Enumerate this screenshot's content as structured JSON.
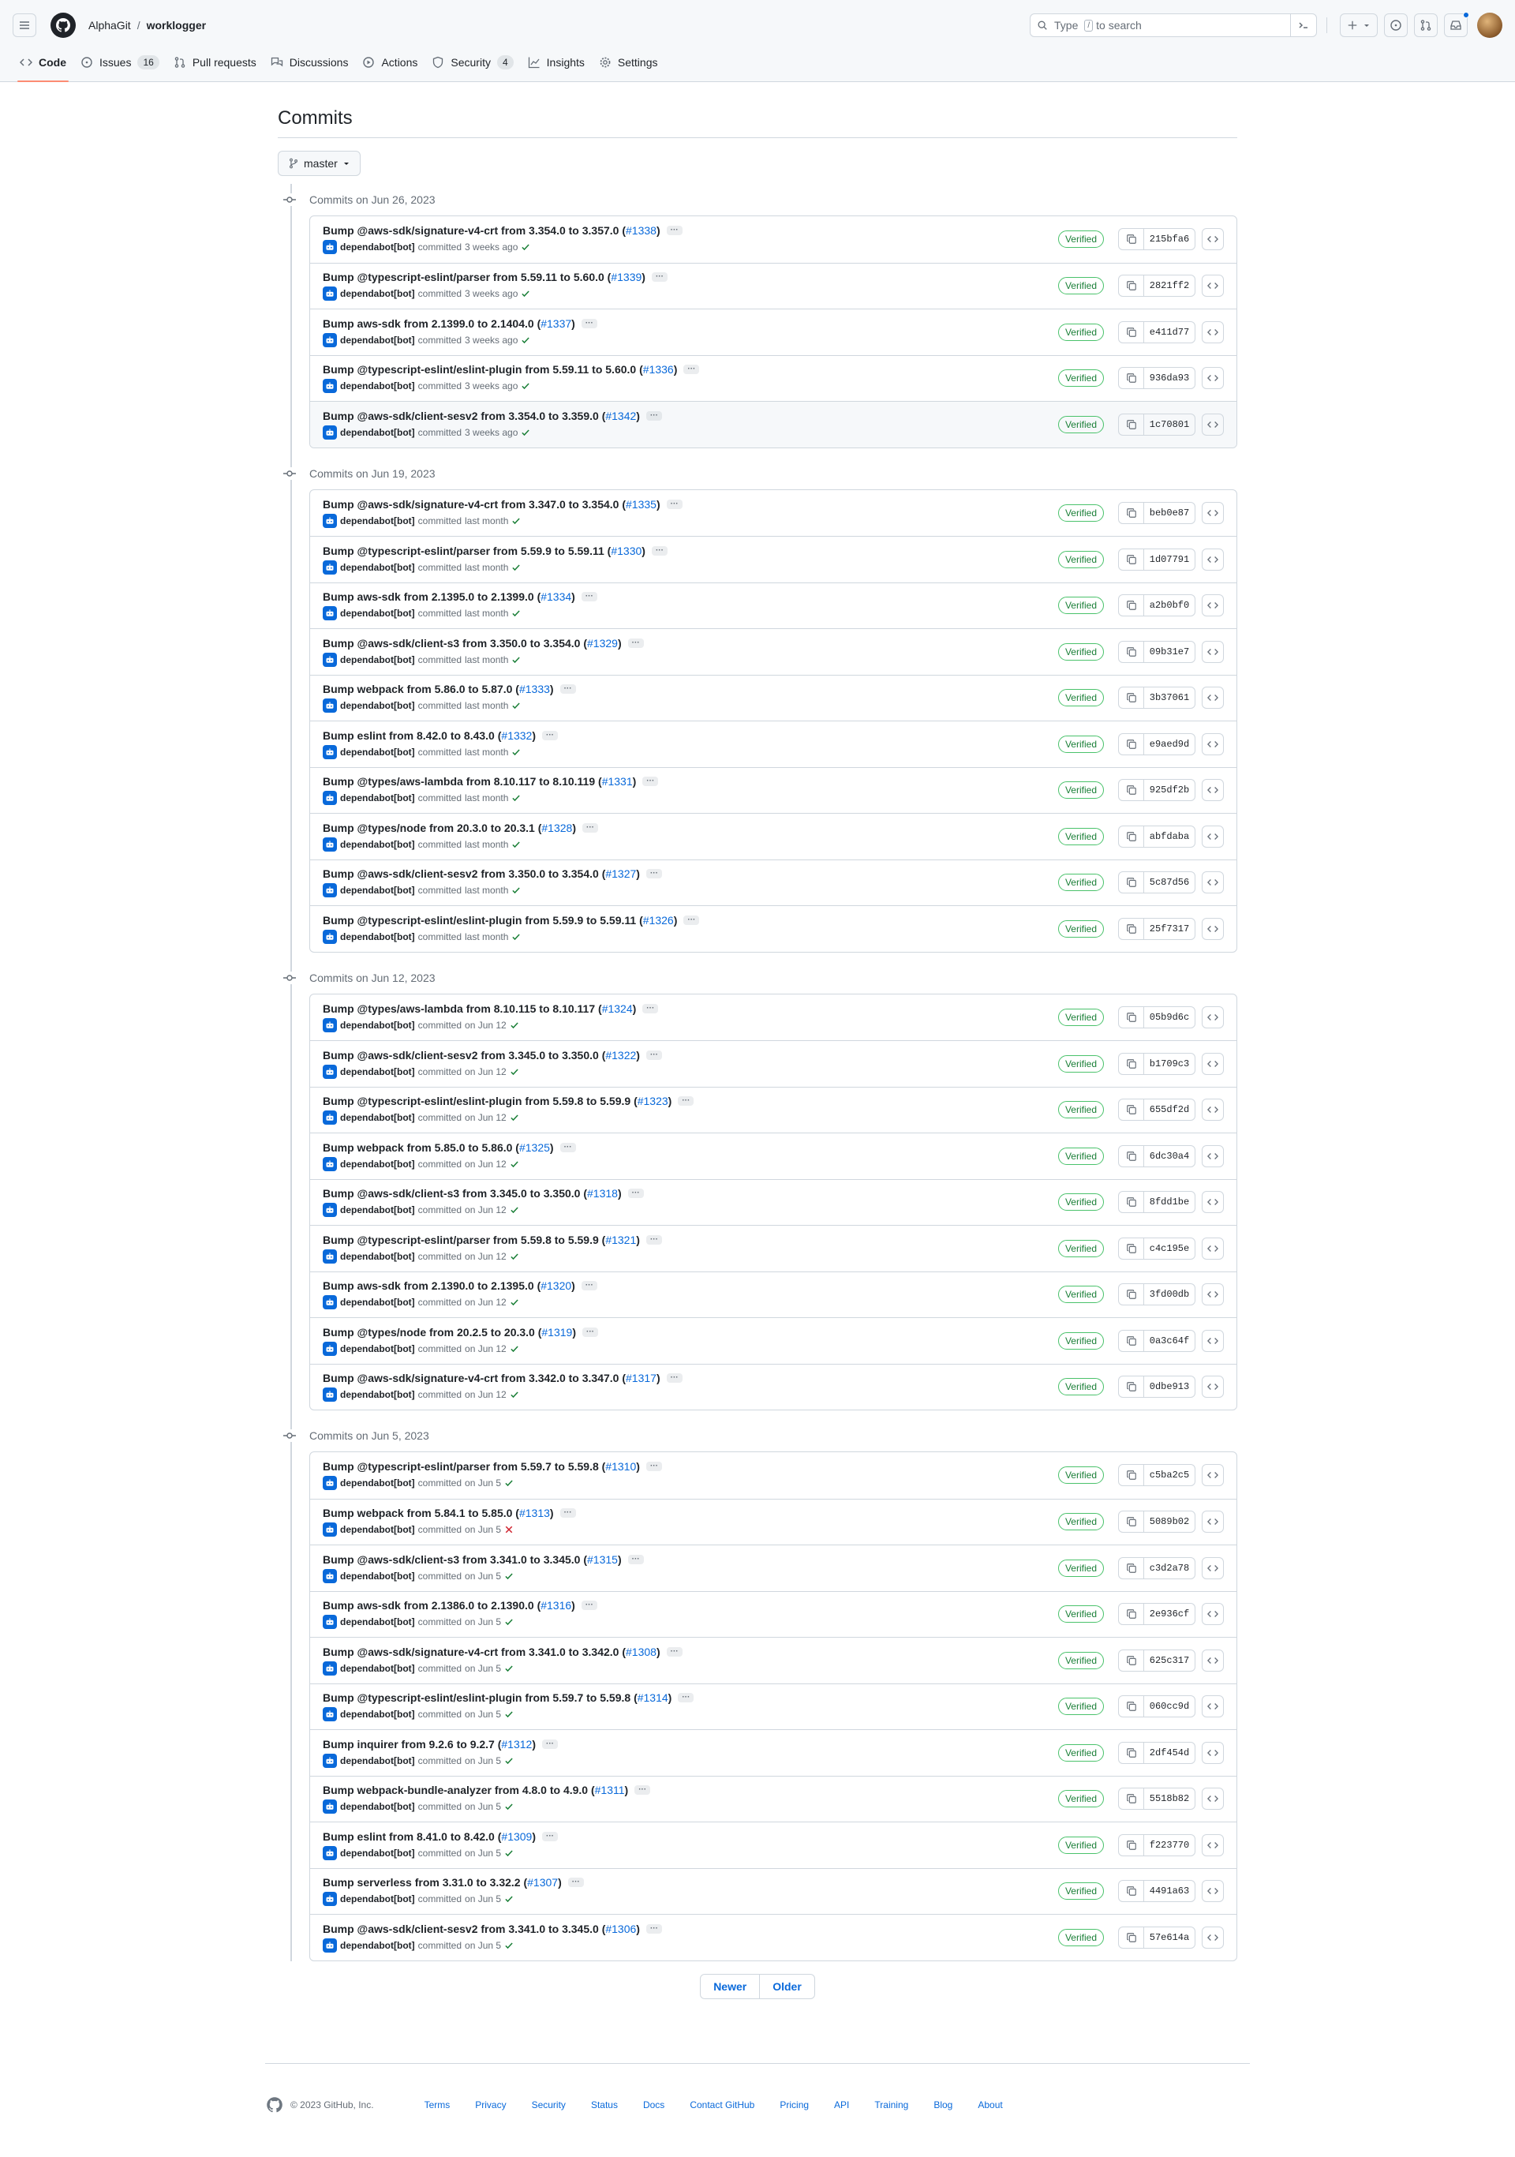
{
  "header": {
    "owner": "AlphaGit",
    "separator": "/",
    "repo": "worklogger",
    "search_prefix": "Type",
    "search_key": "/",
    "search_suffix": "to search"
  },
  "tabs": [
    {
      "label": "Code",
      "icon": "code-icon",
      "selected": true,
      "count": ""
    },
    {
      "label": "Issues",
      "icon": "issue-opened-icon",
      "count": "16"
    },
    {
      "label": "Pull requests",
      "icon": "git-pull-request-icon",
      "count": ""
    },
    {
      "label": "Discussions",
      "icon": "comment-discussion-icon",
      "count": ""
    },
    {
      "label": "Actions",
      "icon": "play-icon",
      "count": ""
    },
    {
      "label": "Security",
      "icon": "shield-icon",
      "count": "4"
    },
    {
      "label": "Insights",
      "icon": "graph-icon",
      "count": ""
    },
    {
      "label": "Settings",
      "icon": "gear-icon",
      "count": ""
    }
  ],
  "page": {
    "title": "Commits",
    "branch": "master",
    "verified_label": "Verified",
    "author": "dependabot[bot]",
    "committed_word": "committed"
  },
  "groups": [
    {
      "date_label": "Commits on Jun 26, 2023",
      "commits": [
        {
          "title": "Bump @aws-sdk/signature-v4-crt from 3.354.0 to 3.357.0 (",
          "pr": "#1338",
          "time": "3 weeks ago",
          "status": "success",
          "sha": "215bfa6"
        },
        {
          "title": "Bump @typescript-eslint/parser from 5.59.11 to 5.60.0 (",
          "pr": "#1339",
          "time": "3 weeks ago",
          "status": "success",
          "sha": "2821ff2"
        },
        {
          "title": "Bump aws-sdk from 2.1399.0 to 2.1404.0 (",
          "pr": "#1337",
          "time": "3 weeks ago",
          "status": "success",
          "sha": "e411d77"
        },
        {
          "title": "Bump @typescript-eslint/eslint-plugin from 5.59.11 to 5.60.0 (",
          "pr": "#1336",
          "time": "3 weeks ago",
          "status": "success",
          "sha": "936da93"
        },
        {
          "title": "Bump @aws-sdk/client-sesv2 from 3.354.0 to 3.359.0 (",
          "pr": "#1342",
          "time": "3 weeks ago",
          "status": "success",
          "sha": "1c70801"
        }
      ]
    },
    {
      "date_label": "Commits on Jun 19, 2023",
      "commits": [
        {
          "title": "Bump @aws-sdk/signature-v4-crt from 3.347.0 to 3.354.0 (",
          "pr": "#1335",
          "time": "last month",
          "status": "success",
          "sha": "beb0e87"
        },
        {
          "title": "Bump @typescript-eslint/parser from 5.59.9 to 5.59.11 (",
          "pr": "#1330",
          "time": "last month",
          "status": "success",
          "sha": "1d07791"
        },
        {
          "title": "Bump aws-sdk from 2.1395.0 to 2.1399.0 (",
          "pr": "#1334",
          "time": "last month",
          "status": "success",
          "sha": "a2b0bf0"
        },
        {
          "title": "Bump @aws-sdk/client-s3 from 3.350.0 to 3.354.0 (",
          "pr": "#1329",
          "time": "last month",
          "status": "success",
          "sha": "09b31e7"
        },
        {
          "title": "Bump webpack from 5.86.0 to 5.87.0 (",
          "pr": "#1333",
          "time": "last month",
          "status": "success",
          "sha": "3b37061"
        },
        {
          "title": "Bump eslint from 8.42.0 to 8.43.0 (",
          "pr": "#1332",
          "time": "last month",
          "status": "success",
          "sha": "e9aed9d"
        },
        {
          "title": "Bump @types/aws-lambda from 8.10.117 to 8.10.119 (",
          "pr": "#1331",
          "time": "last month",
          "status": "success",
          "sha": "925df2b"
        },
        {
          "title": "Bump @types/node from 20.3.0 to 20.3.1 (",
          "pr": "#1328",
          "time": "last month",
          "status": "success",
          "sha": "abfdaba"
        },
        {
          "title": "Bump @aws-sdk/client-sesv2 from 3.350.0 to 3.354.0 (",
          "pr": "#1327",
          "time": "last month",
          "status": "success",
          "sha": "5c87d56"
        },
        {
          "title": "Bump @typescript-eslint/eslint-plugin from 5.59.9 to 5.59.11 (",
          "pr": "#1326",
          "time": "last month",
          "status": "success",
          "sha": "25f7317"
        }
      ]
    },
    {
      "date_label": "Commits on Jun 12, 2023",
      "commits": [
        {
          "title": "Bump @types/aws-lambda from 8.10.115 to 8.10.117 (",
          "pr": "#1324",
          "time": "on Jun 12",
          "status": "success",
          "sha": "05b9d6c"
        },
        {
          "title": "Bump @aws-sdk/client-sesv2 from 3.345.0 to 3.350.0 (",
          "pr": "#1322",
          "time": "on Jun 12",
          "status": "success",
          "sha": "b1709c3"
        },
        {
          "title": "Bump @typescript-eslint/eslint-plugin from 5.59.8 to 5.59.9 (",
          "pr": "#1323",
          "time": "on Jun 12",
          "status": "success",
          "sha": "655df2d"
        },
        {
          "title": "Bump webpack from 5.85.0 to 5.86.0 (",
          "pr": "#1325",
          "time": "on Jun 12",
          "status": "success",
          "sha": "6dc30a4"
        },
        {
          "title": "Bump @aws-sdk/client-s3 from 3.345.0 to 3.350.0 (",
          "pr": "#1318",
          "time": "on Jun 12",
          "status": "success",
          "sha": "8fdd1be"
        },
        {
          "title": "Bump @typescript-eslint/parser from 5.59.8 to 5.59.9 (",
          "pr": "#1321",
          "time": "on Jun 12",
          "status": "success",
          "sha": "c4c195e"
        },
        {
          "title": "Bump aws-sdk from 2.1390.0 to 2.1395.0 (",
          "pr": "#1320",
          "time": "on Jun 12",
          "status": "success",
          "sha": "3fd00db"
        },
        {
          "title": "Bump @types/node from 20.2.5 to 20.3.0 (",
          "pr": "#1319",
          "time": "on Jun 12",
          "status": "success",
          "sha": "0a3c64f"
        },
        {
          "title": "Bump @aws-sdk/signature-v4-crt from 3.342.0 to 3.347.0 (",
          "pr": "#1317",
          "time": "on Jun 12",
          "status": "success",
          "sha": "0dbe913"
        }
      ]
    },
    {
      "date_label": "Commits on Jun 5, 2023",
      "commits": [
        {
          "title": "Bump @typescript-eslint/parser from 5.59.7 to 5.59.8 (",
          "pr": "#1310",
          "time": "on Jun 5",
          "status": "success",
          "sha": "c5ba2c5"
        },
        {
          "title": "Bump webpack from 5.84.1 to 5.85.0 (",
          "pr": "#1313",
          "time": "on Jun 5",
          "status": "failure",
          "sha": "5089b02"
        },
        {
          "title": "Bump @aws-sdk/client-s3 from 3.341.0 to 3.345.0 (",
          "pr": "#1315",
          "time": "on Jun 5",
          "status": "success",
          "sha": "c3d2a78"
        },
        {
          "title": "Bump aws-sdk from 2.1386.0 to 2.1390.0 (",
          "pr": "#1316",
          "time": "on Jun 5",
          "status": "success",
          "sha": "2e936cf"
        },
        {
          "title": "Bump @aws-sdk/signature-v4-crt from 3.341.0 to 3.342.0 (",
          "pr": "#1308",
          "time": "on Jun 5",
          "status": "success",
          "sha": "625c317"
        },
        {
          "title": "Bump @typescript-eslint/eslint-plugin from 5.59.7 to 5.59.8 (",
          "pr": "#1314",
          "time": "on Jun 5",
          "status": "success",
          "sha": "060cc9d"
        },
        {
          "title": "Bump inquirer from 9.2.6 to 9.2.7 (",
          "pr": "#1312",
          "time": "on Jun 5",
          "status": "success",
          "sha": "2df454d"
        },
        {
          "title": "Bump webpack-bundle-analyzer from 4.8.0 to 4.9.0 (",
          "pr": "#1311",
          "time": "on Jun 5",
          "status": "success",
          "sha": "5518b82"
        },
        {
          "title": "Bump eslint from 8.41.0 to 8.42.0 (",
          "pr": "#1309",
          "time": "on Jun 5",
          "status": "success",
          "sha": "f223770"
        },
        {
          "title": "Bump serverless from 3.31.0 to 3.32.2 (",
          "pr": "#1307",
          "time": "on Jun 5",
          "status": "success",
          "sha": "4491a63"
        },
        {
          "title": "Bump @aws-sdk/client-sesv2 from 3.341.0 to 3.345.0 (",
          "pr": "#1306",
          "time": "on Jun 5",
          "status": "success",
          "sha": "57e614a"
        }
      ]
    }
  ],
  "pagination": {
    "newer": "Newer",
    "older": "Older"
  },
  "footer": {
    "copyright": "© 2023 GitHub, Inc.",
    "links": [
      "Terms",
      "Privacy",
      "Security",
      "Status",
      "Docs",
      "Contact GitHub",
      "Pricing",
      "API",
      "Training",
      "Blog",
      "About"
    ]
  },
  "colors": {
    "accent": "#0969da",
    "verified": "#1a7f37",
    "failure": "#cf222e",
    "tab_underline": "#fd8c73"
  }
}
